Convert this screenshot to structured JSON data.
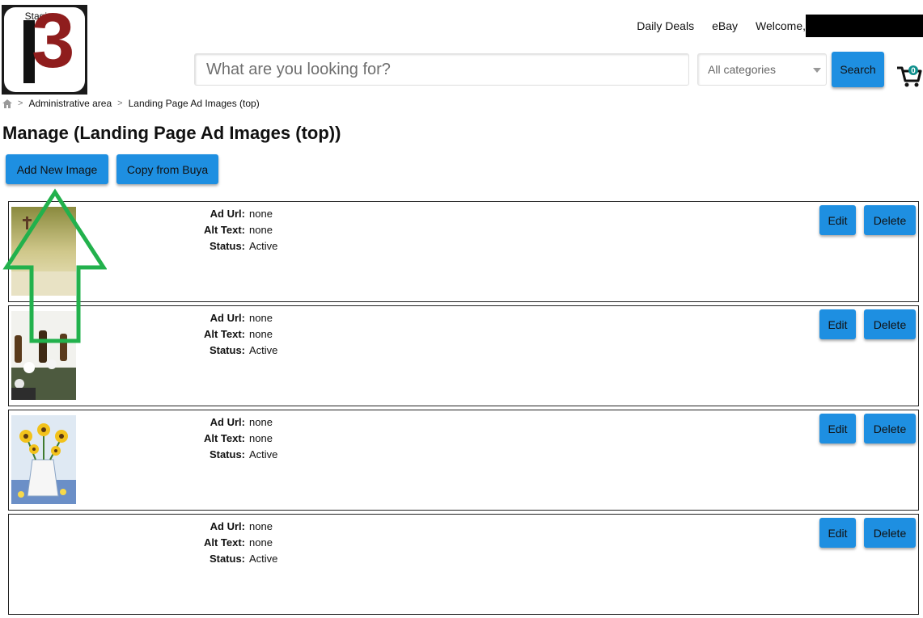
{
  "header": {
    "logo_staging": "Staging",
    "nav": {
      "daily_deals": "Daily Deals",
      "ebay": "eBay",
      "welcome": "Welcome,"
    },
    "search": {
      "placeholder": "What are you looking for?",
      "category": "All categories",
      "button": "Search"
    },
    "cart_count": "0"
  },
  "breadcrumb": {
    "sep": ">",
    "items": [
      "Administrative area",
      "Landing Page Ad Images (top)"
    ]
  },
  "page_title": "Manage (Landing Page Ad Images (top))",
  "actions": {
    "add": "Add New Image",
    "copy": "Copy from Buya"
  },
  "labels": {
    "ad_url": "Ad Url:",
    "alt_text": "Alt Text:",
    "status": "Status:",
    "edit": "Edit",
    "delete": "Delete"
  },
  "rows": [
    {
      "ad_url": "none",
      "alt_text": "none",
      "status": "Active",
      "thumb": "landscape-painting"
    },
    {
      "ad_url": "none",
      "alt_text": "none",
      "status": "Active",
      "thumb": "bottles-painting"
    },
    {
      "ad_url": "none",
      "alt_text": "none",
      "status": "Active",
      "thumb": "sunflowers-painting"
    },
    {
      "ad_url": "none",
      "alt_text": "none",
      "status": "Active",
      "thumb": "none"
    }
  ],
  "colors": {
    "button": "#1e8fe1",
    "arrow": "#22b14c",
    "logo_b": "#8f1d1d"
  }
}
